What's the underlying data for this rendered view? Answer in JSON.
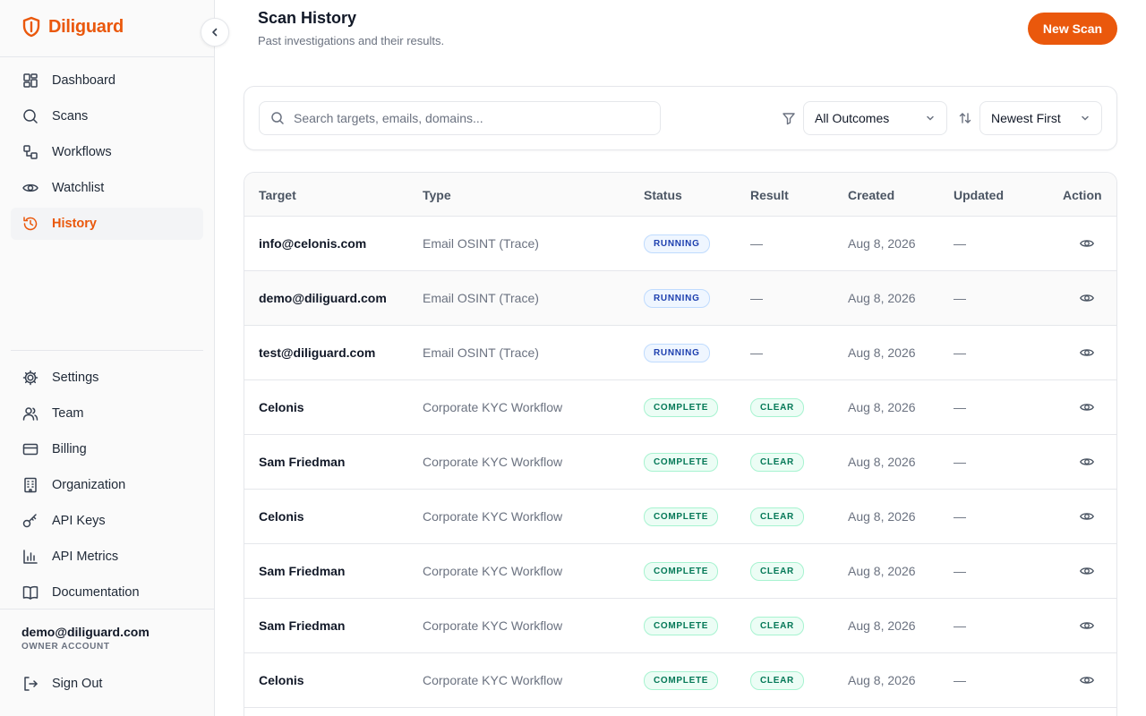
{
  "brand": {
    "name": "Diliguard",
    "color": "#ea580c"
  },
  "sidebar": {
    "primary": [
      {
        "label": "Dashboard",
        "icon": "dashboard-icon"
      },
      {
        "label": "Scans",
        "icon": "search-icon"
      },
      {
        "label": "Workflows",
        "icon": "workflow-icon"
      },
      {
        "label": "Watchlist",
        "icon": "eye-icon"
      },
      {
        "label": "History",
        "icon": "history-icon",
        "active": true
      }
    ],
    "secondary": [
      {
        "label": "Settings",
        "icon": "gear-icon"
      },
      {
        "label": "Team",
        "icon": "users-icon"
      },
      {
        "label": "Billing",
        "icon": "credit-card-icon"
      },
      {
        "label": "Organization",
        "icon": "building-icon"
      },
      {
        "label": "API Keys",
        "icon": "key-icon"
      },
      {
        "label": "API Metrics",
        "icon": "bar-chart-icon"
      },
      {
        "label": "Documentation",
        "icon": "book-icon"
      }
    ],
    "account": {
      "email": "demo@diliguard.com",
      "role": "OWNER ACCOUNT"
    },
    "sign_out": "Sign Out"
  },
  "header": {
    "title": "Scan History",
    "subtitle": "Past investigations and their results.",
    "new_scan": "New Scan"
  },
  "filters": {
    "search_placeholder": "Search targets, emails, domains...",
    "outcome": "All Outcomes",
    "sort": "Newest First"
  },
  "table": {
    "columns": {
      "target": "Target",
      "type": "Type",
      "status": "Status",
      "result": "Result",
      "created": "Created",
      "updated": "Updated",
      "action": "Action"
    },
    "rows": [
      {
        "target": "info@celonis.com",
        "type": "Email OSINT (Trace)",
        "status": "RUNNING",
        "result": "—",
        "created": "Aug 8, 2026",
        "updated": "—"
      },
      {
        "target": "demo@diliguard.com",
        "type": "Email OSINT (Trace)",
        "status": "RUNNING",
        "result": "—",
        "created": "Aug 8, 2026",
        "updated": "—"
      },
      {
        "target": "test@diliguard.com",
        "type": "Email OSINT (Trace)",
        "status": "RUNNING",
        "result": "—",
        "created": "Aug 8, 2026",
        "updated": "—"
      },
      {
        "target": "Celonis",
        "type": "Corporate KYC Workflow",
        "status": "COMPLETE",
        "result": "CLEAR",
        "created": "Aug 8, 2026",
        "updated": "—"
      },
      {
        "target": "Sam Friedman",
        "type": "Corporate KYC Workflow",
        "status": "COMPLETE",
        "result": "CLEAR",
        "created": "Aug 8, 2026",
        "updated": "—"
      },
      {
        "target": "Celonis",
        "type": "Corporate KYC Workflow",
        "status": "COMPLETE",
        "result": "CLEAR",
        "created": "Aug 8, 2026",
        "updated": "—"
      },
      {
        "target": "Sam Friedman",
        "type": "Corporate KYC Workflow",
        "status": "COMPLETE",
        "result": "CLEAR",
        "created": "Aug 8, 2026",
        "updated": "—"
      },
      {
        "target": "Sam Friedman",
        "type": "Corporate KYC Workflow",
        "status": "COMPLETE",
        "result": "CLEAR",
        "created": "Aug 8, 2026",
        "updated": "—"
      },
      {
        "target": "Celonis",
        "type": "Corporate KYC Workflow",
        "status": "COMPLETE",
        "result": "CLEAR",
        "created": "Aug 8, 2026",
        "updated": "—"
      }
    ]
  }
}
